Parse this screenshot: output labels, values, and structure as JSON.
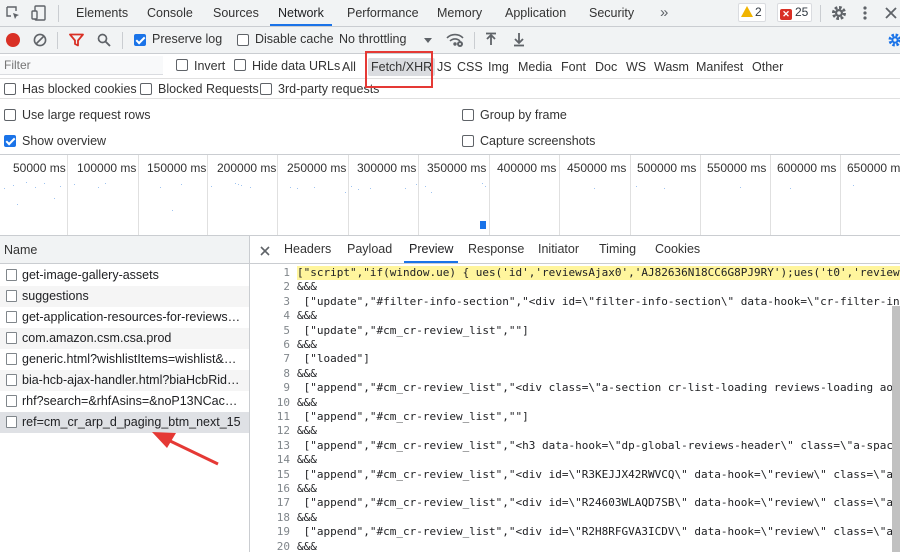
{
  "top_tabs": [
    "Elements",
    "Console",
    "Sources",
    "Network",
    "Performance",
    "Memory",
    "Application",
    "Security"
  ],
  "more_tabs": "»",
  "warnings_count": "2",
  "errors_count": "25",
  "toolbar": {
    "preserve_log": "Preserve log",
    "disable_cache": "Disable cache",
    "throttling": "No throttling"
  },
  "filter": {
    "placeholder": "Filter",
    "invert": "Invert",
    "hide_data_urls": "Hide data URLs",
    "types": [
      "All",
      "Fetch/XHR",
      "JS",
      "CSS",
      "Img",
      "Media",
      "Font",
      "Doc",
      "WS",
      "Wasm",
      "Manifest",
      "Other"
    ],
    "selected": "Fetch/XHR",
    "has_blocked_cookies": "Has blocked cookies",
    "blocked_requests": "Blocked Requests",
    "third_party": "3rd-party requests"
  },
  "options": {
    "large_rows": "Use large request rows",
    "show_overview": "Show overview",
    "group_by_frame": "Group by frame",
    "capture_screenshots": "Capture screenshots"
  },
  "overview_ticks": [
    "50000 ms",
    "100000 ms",
    "150000 ms",
    "200000 ms",
    "250000 ms",
    "300000 ms",
    "350000 ms",
    "400000 ms",
    "450000 ms",
    "500000 ms",
    "550000 ms",
    "600000 ms",
    "650000 ms"
  ],
  "requests": {
    "header": "Name",
    "rows": [
      "get-image-gallery-assets",
      "suggestions",
      "get-application-resources-for-reviews-g...",
      "com.amazon.csm.csa.prod",
      "generic.html?wishlistItems=wishlist&me...",
      "bia-hcb-ajax-handler.html?biaHcbRid=...",
      "rhf?search=&rhfAsins=&noP13NCache...",
      "ref=cm_cr_arp_d_paging_btm_next_15"
    ]
  },
  "detail_tabs": [
    "Headers",
    "Payload",
    "Preview",
    "Response",
    "Initiator",
    "Timing",
    "Cookies"
  ],
  "detail_active": "Preview",
  "preview_lines": [
    {
      "n": "1",
      "t": "[\"script\",\"if(window.ue) { ues('id','reviewsAjax0','AJ82636N18CC6G8PJ9RY');ues('t0','review"
    },
    {
      "n": "2",
      "t": "&&&"
    },
    {
      "n": "3",
      "t": " [\"update\",\"#filter-info-section\",\"<div id=\\\"filter-info-section\\\" data-hook=\\\"cr-filter-in"
    },
    {
      "n": "4",
      "t": "&&&"
    },
    {
      "n": "5",
      "t": " [\"update\",\"#cm_cr-review_list\",\"\"]"
    },
    {
      "n": "6",
      "t": "&&&"
    },
    {
      "n": "7",
      "t": " [\"loaded\"]"
    },
    {
      "n": "8",
      "t": "&&&"
    },
    {
      "n": "9",
      "t": " [\"append\",\"#cm_cr-review_list\",\"<div class=\\\"a-section cr-list-loading reviews-loading aok"
    },
    {
      "n": "10",
      "t": "&&&"
    },
    {
      "n": "11",
      "t": " [\"append\",\"#cm_cr-review_list\",\"\"]"
    },
    {
      "n": "12",
      "t": "&&&"
    },
    {
      "n": "13",
      "t": " [\"append\",\"#cm_cr-review_list\",\"<h3 data-hook=\\\"dp-global-reviews-header\\\" class=\\\"a-spaci"
    },
    {
      "n": "14",
      "t": "&&&"
    },
    {
      "n": "15",
      "t": " [\"append\",\"#cm_cr-review_list\",\"<div id=\\\"R3KEJJX42RWVCQ\\\" data-hook=\\\"review\\\" class=\\\"a-"
    },
    {
      "n": "16",
      "t": "&&&"
    },
    {
      "n": "17",
      "t": " [\"append\",\"#cm_cr-review_list\",\"<div id=\\\"R24603WLAQD7SB\\\" data-hook=\\\"review\\\" class=\\\"a-"
    },
    {
      "n": "18",
      "t": "&&&"
    },
    {
      "n": "19",
      "t": " [\"append\",\"#cm_cr-review_list\",\"<div id=\\\"R2H8RFGVA3ICDV\\\" data-hook=\\\"review\\\" class=\\\"a-"
    },
    {
      "n": "20",
      "t": "&&&"
    }
  ],
  "colors": {
    "accent": "#1a73e8",
    "annotation_red": "#e53935",
    "highlight": "#fff59d",
    "record": "#d93025"
  }
}
